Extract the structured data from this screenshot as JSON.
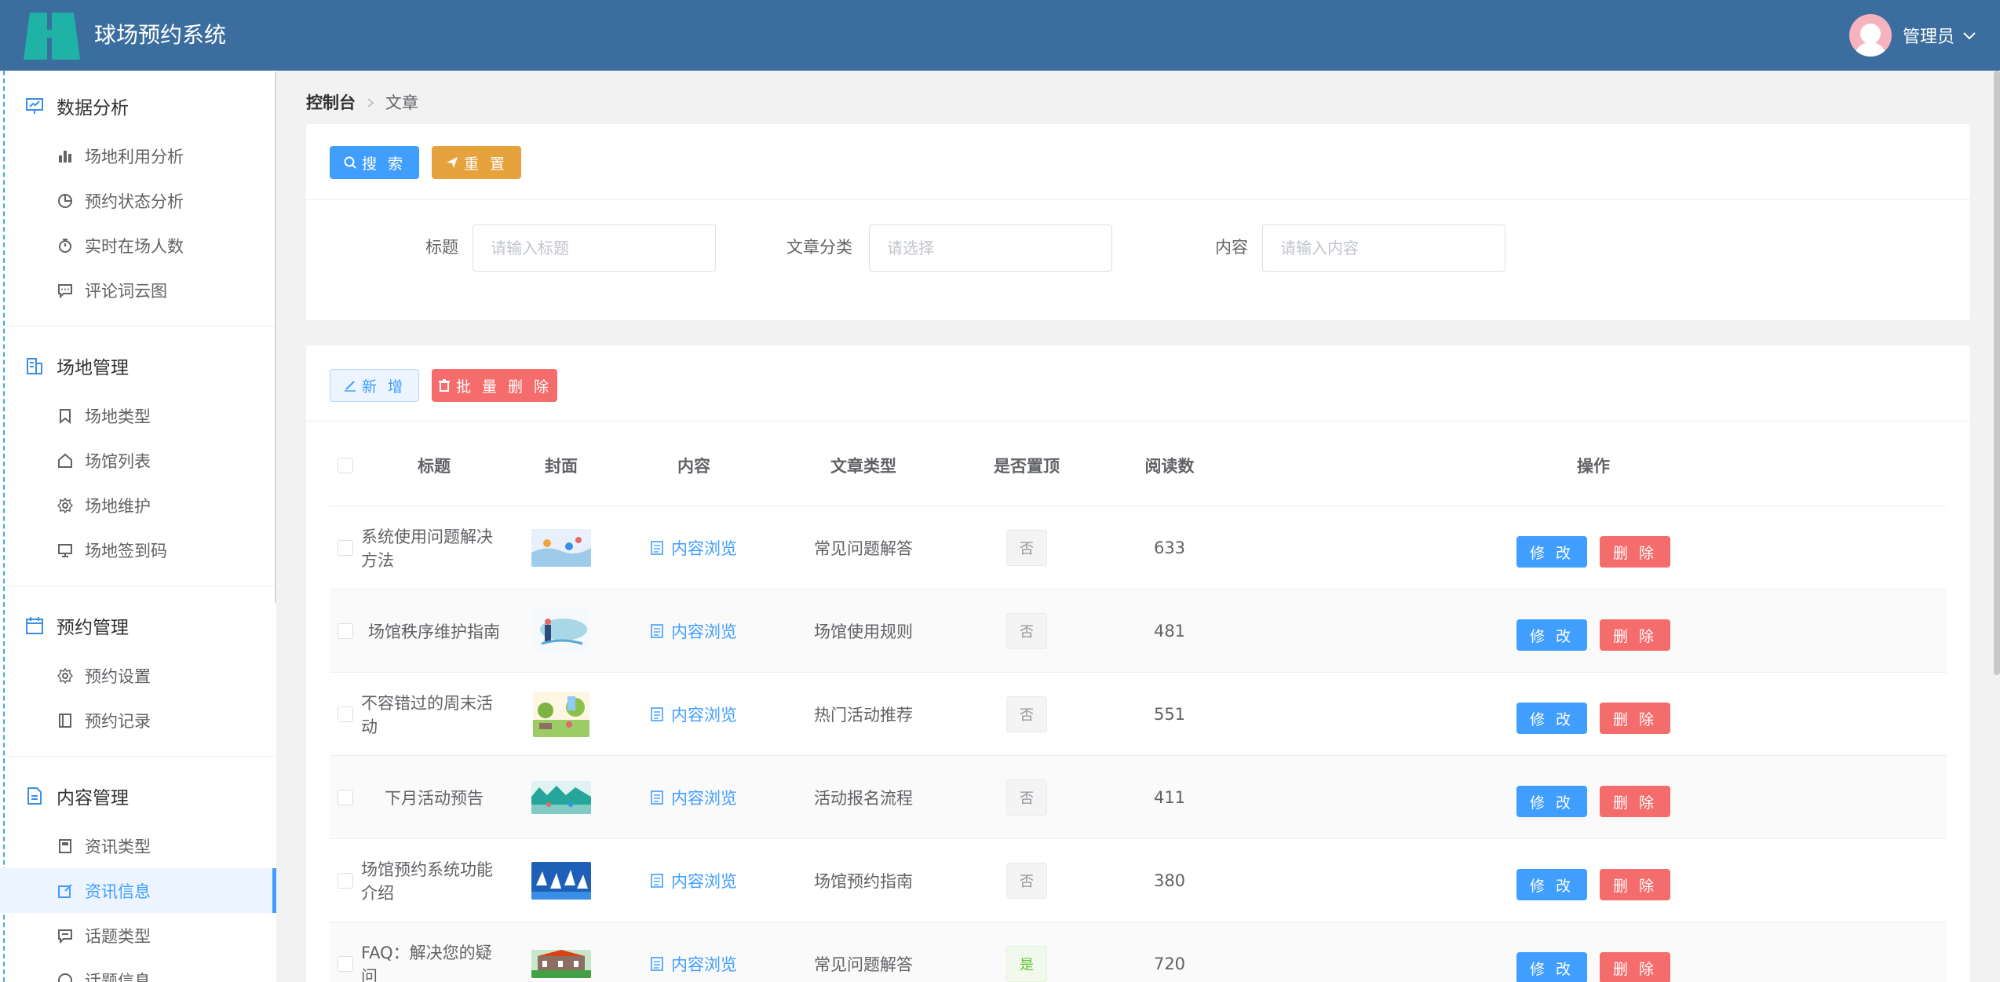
{
  "header": {
    "title": "球场预约系统",
    "user_name": "管理员"
  },
  "sidebar": {
    "groups": [
      {
        "title": "数据分析",
        "items": [
          "场地利用分析",
          "预约状态分析",
          "实时在场人数",
          "评论词云图"
        ]
      },
      {
        "title": "场地管理",
        "items": [
          "场地类型",
          "场馆列表",
          "场地维护",
          "场地签到码"
        ]
      },
      {
        "title": "预约管理",
        "items": [
          "预约设置",
          "预约记录"
        ]
      },
      {
        "title": "内容管理",
        "items": [
          "资讯类型",
          "资讯信息",
          "话题类型",
          "话题信息"
        ],
        "active_index": 1
      }
    ]
  },
  "breadcrumb": {
    "root": "控制台",
    "current": "文章"
  },
  "search_panel": {
    "search_label": "搜 索",
    "reset_label": "重 置",
    "fields": [
      {
        "label": "标题",
        "placeholder": "请输入标题",
        "value": ""
      },
      {
        "label": "文章分类",
        "placeholder": "请选择",
        "value": ""
      },
      {
        "label": "内容",
        "placeholder": "请输入内容",
        "value": ""
      }
    ]
  },
  "toolbar": {
    "add_label": "新 增",
    "batch_delete_label": "批 量 删 除"
  },
  "table": {
    "columns": [
      "标题",
      "封面",
      "内容",
      "文章类型",
      "是否置顶",
      "阅读数",
      "操作"
    ],
    "rows": [
      {
        "title": "系统使用问题解决方法",
        "content_link": "内容浏览",
        "type": "常见问题解答",
        "top": "否",
        "reads": "633"
      },
      {
        "title": "场馆秩序维护指南",
        "content_link": "内容浏览",
        "type": "场馆使用规则",
        "top": "否",
        "reads": "481"
      },
      {
        "title": "不容错过的周末活动",
        "content_link": "内容浏览",
        "type": "热门活动推荐",
        "top": "否",
        "reads": "551"
      },
      {
        "title": "下月活动预告",
        "content_link": "内容浏览",
        "type": "活动报名流程",
        "top": "否",
        "reads": "411"
      },
      {
        "title": "场馆预约系统功能介绍",
        "content_link": "内容浏览",
        "type": "场馆预约指南",
        "top": "否",
        "reads": "380"
      },
      {
        "title": "FAQ：解决您的疑问",
        "content_link": "内容浏览",
        "type": "常见问题解答",
        "top": "是",
        "reads": "720"
      }
    ],
    "edit_label": "修 改",
    "delete_label": "删 除"
  },
  "colors": {
    "header_bg": "#3b6e9f",
    "primary": "#409eff",
    "warning": "#e6a23c",
    "danger": "#f56c6c",
    "success": "#67c23a"
  }
}
